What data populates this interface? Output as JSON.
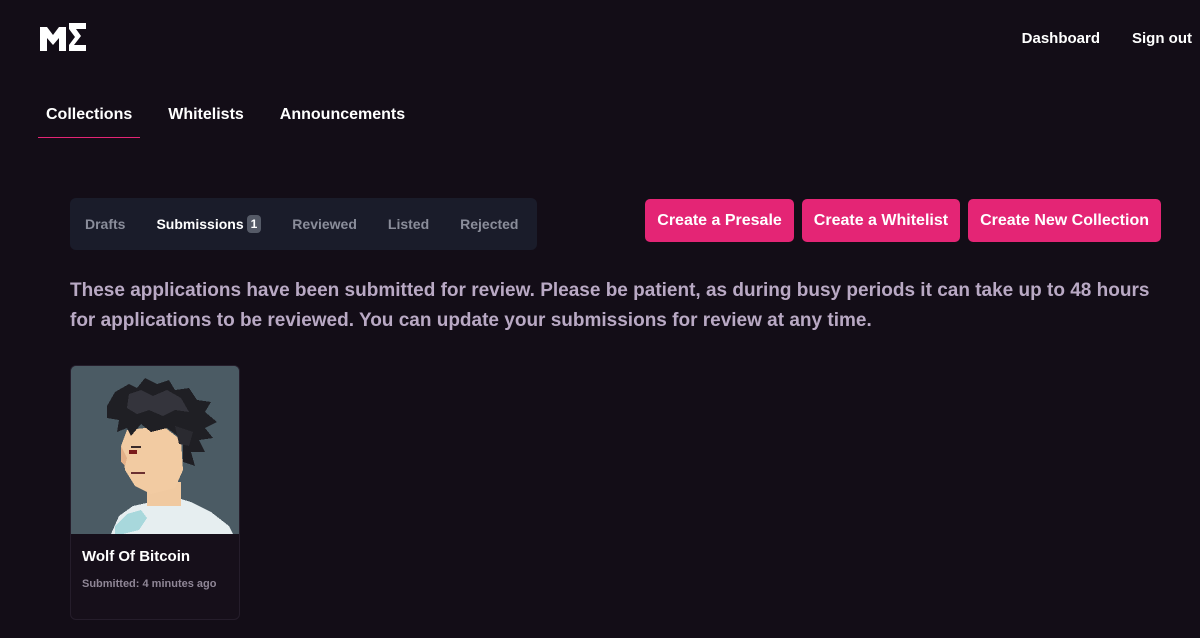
{
  "header": {
    "logo_icon": "magic-eden-logo-icon",
    "nav": [
      {
        "label": "Dashboard"
      },
      {
        "label": "Sign out"
      }
    ]
  },
  "main_tabs": [
    {
      "label": "Collections",
      "active": true
    },
    {
      "label": "Whitelists",
      "active": false
    },
    {
      "label": "Announcements",
      "active": false
    }
  ],
  "sub_tabs": [
    {
      "label": "Drafts",
      "active": false
    },
    {
      "label": "Submissions",
      "active": true,
      "badge": "1"
    },
    {
      "label": "Reviewed",
      "active": false
    },
    {
      "label": "Listed",
      "active": false
    },
    {
      "label": "Rejected",
      "active": false
    }
  ],
  "actions": [
    {
      "label": "Create a Presale"
    },
    {
      "label": "Create a Whitelist"
    },
    {
      "label": "Create New Collection"
    }
  ],
  "description": "These applications have been submitted for review. Please be patient, as during busy periods it can take up to 48 hours for applications to be reviewed. You can update your submissions for review at any time.",
  "cards": [
    {
      "title": "Wolf Of Bitcoin",
      "meta": "Submitted: 4 minutes ago"
    }
  ],
  "colors": {
    "background": "#130d17",
    "accent": "#e42575",
    "description_text": "#b9a9c4",
    "subtabs_bg": "#1a1c2a"
  }
}
